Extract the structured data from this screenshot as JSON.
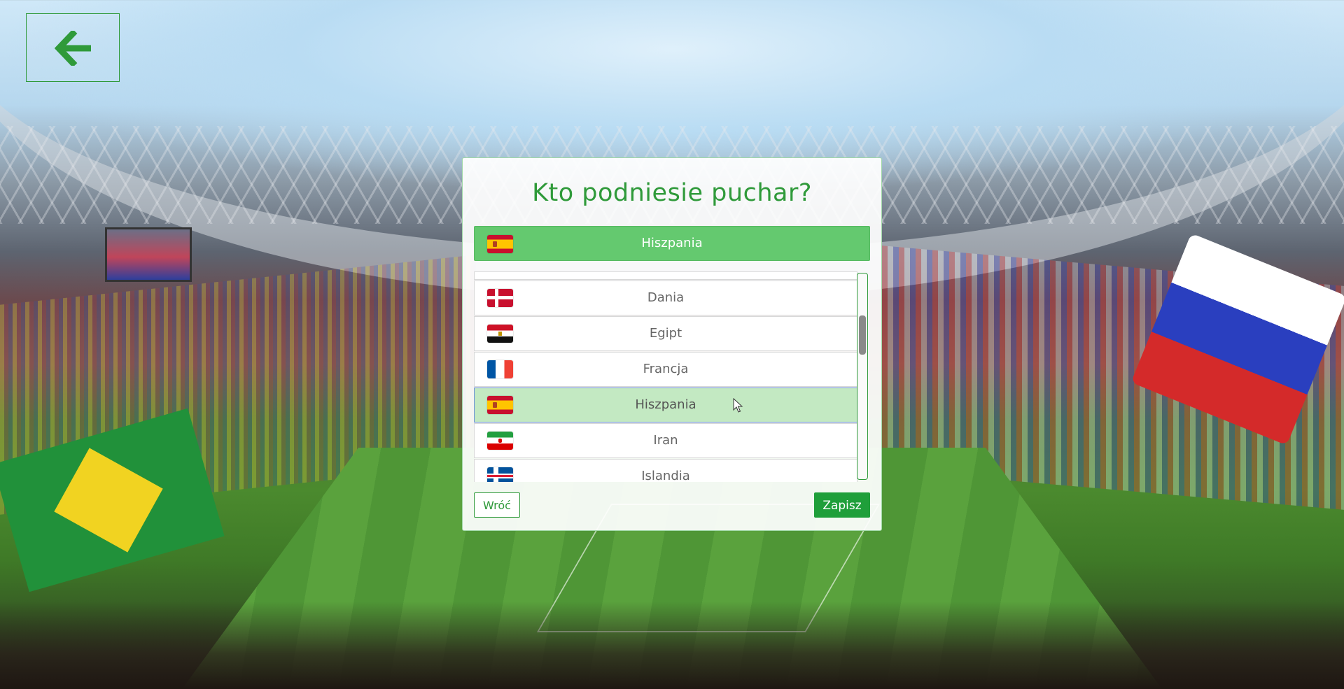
{
  "dialog": {
    "title": "Kto podniesie puchar?",
    "selected": {
      "label": "Hiszpania",
      "flag": "flag-spain"
    },
    "countries": [
      {
        "label": "",
        "flag": "flag-partial"
      },
      {
        "label": "Dania",
        "flag": "flag-denmark"
      },
      {
        "label": "Egipt",
        "flag": "flag-egypt"
      },
      {
        "label": "Francja",
        "flag": "flag-france"
      },
      {
        "label": "Hiszpania",
        "flag": "flag-spain",
        "highlighted": true
      },
      {
        "label": "Iran",
        "flag": "flag-iran"
      },
      {
        "label": "Islandia",
        "flag": "flag-iceland"
      }
    ],
    "back_label": "Wróć",
    "save_label": "Zapisz"
  },
  "nav": {
    "back_icon": "arrow-left-icon"
  },
  "colors": {
    "accent": "#2f9a3a",
    "selected_bg": "#64c96f",
    "highlight_bg": "#c3e9c2",
    "save_bg": "#1f9f3a"
  }
}
